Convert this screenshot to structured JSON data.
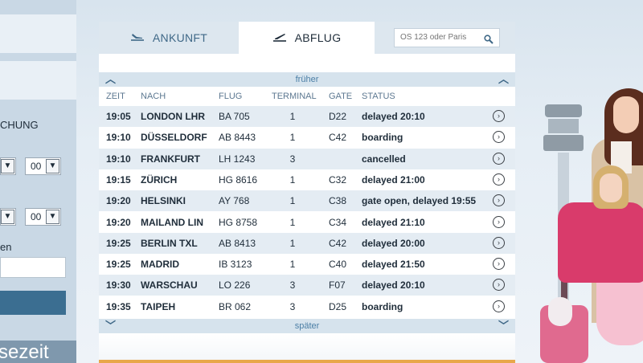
{
  "left_panel": {
    "booking_label": "CHUNG",
    "select1": {
      "hour": "",
      "minute": "00"
    },
    "select2": {
      "hour": "",
      "minute": "00"
    },
    "text_label": "en",
    "bottom_label": "sezeit"
  },
  "tabs": {
    "arrival": {
      "label": "ANKUNFT",
      "icon": "plane-landing-icon"
    },
    "departure": {
      "label": "ABFLUG",
      "icon": "plane-takeoff-icon"
    }
  },
  "search": {
    "placeholder": "OS 123 oder Paris",
    "icon": "search-icon"
  },
  "nav": {
    "earlier": "früher",
    "later": "später"
  },
  "columns": {
    "time": "ZEIT",
    "destination": "NACH",
    "flight": "FLUG",
    "terminal": "TERMINAL",
    "gate": "GATE",
    "status": "STATUS"
  },
  "flights": [
    {
      "time": "19:05",
      "destination": "LONDON LHR",
      "flight": "BA 705",
      "terminal": "1",
      "gate": "D22",
      "status": "delayed 20:10"
    },
    {
      "time": "19:10",
      "destination": "DÜSSELDORF",
      "flight": "AB 8443",
      "terminal": "1",
      "gate": "C42",
      "status": "boarding"
    },
    {
      "time": "19:10",
      "destination": "FRANKFURT",
      "flight": "LH 1243",
      "terminal": "3",
      "gate": "",
      "status": "cancelled"
    },
    {
      "time": "19:15",
      "destination": "ZÜRICH",
      "flight": "HG 8616",
      "terminal": "1",
      "gate": "C32",
      "status": "delayed 21:00"
    },
    {
      "time": "19:20",
      "destination": "HELSINKI",
      "flight": "AY 768",
      "terminal": "1",
      "gate": "C38",
      "status": "gate open, delayed 19:55"
    },
    {
      "time": "19:20",
      "destination": "MAILAND LIN",
      "flight": "HG 8758",
      "terminal": "1",
      "gate": "C34",
      "status": "delayed 21:10"
    },
    {
      "time": "19:25",
      "destination": "BERLIN TXL",
      "flight": "AB 8413",
      "terminal": "1",
      "gate": "C42",
      "status": "delayed 20:00"
    },
    {
      "time": "19:25",
      "destination": "MADRID",
      "flight": "IB 3123",
      "terminal": "1",
      "gate": "C40",
      "status": "delayed 21:50"
    },
    {
      "time": "19:30",
      "destination": "WARSCHAU",
      "flight": "LO 226",
      "terminal": "3",
      "gate": "F07",
      "status": "delayed 20:10"
    },
    {
      "time": "19:35",
      "destination": "TAIPEH",
      "flight": "BR 062",
      "terminal": "3",
      "gate": "D25",
      "status": "boarding"
    }
  ],
  "colors": {
    "accent": "#3f6887",
    "nav_bar": "#d6e3ed",
    "row_alt": "#e4ecf3",
    "button": "#3b6e91"
  }
}
